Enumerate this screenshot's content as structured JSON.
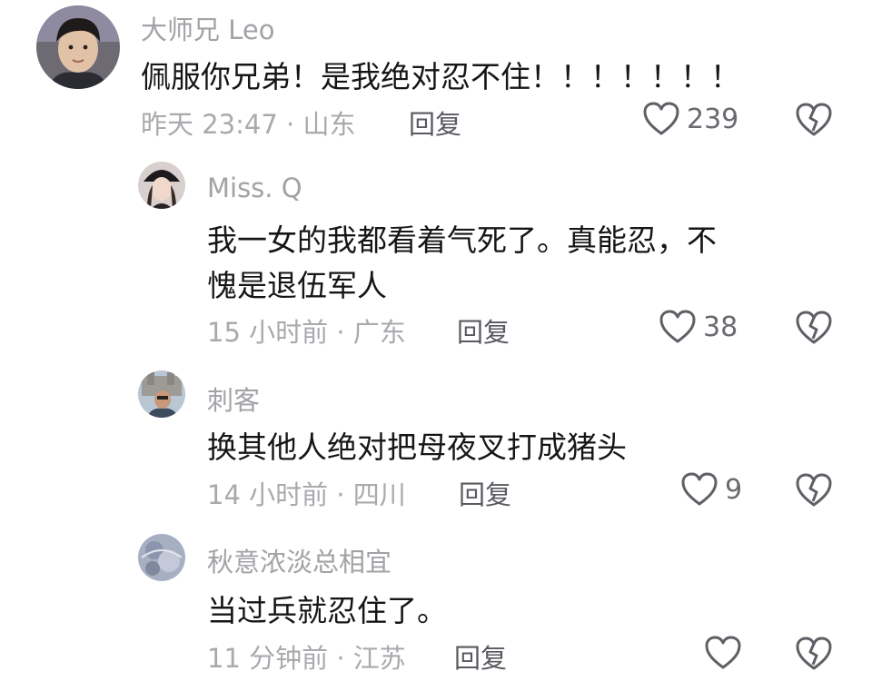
{
  "comments": [
    {
      "username": "大师兄 Leo",
      "text": "佩服你兄弟！是我绝对忍不住！！！！！！！",
      "meta": "昨天 23:47 · 山东",
      "reply": "回复",
      "likes": "239"
    },
    {
      "username": "Miss. Q",
      "text_line1": "我一女的我都看着气死了。真能忍，不",
      "text_line2": "愧是退伍军人",
      "meta": "15 小时前 · 广东",
      "reply": "回复",
      "likes": "38"
    },
    {
      "username": "刺客",
      "text": "换其他人绝对把母夜叉打成猪头",
      "meta": "14 小时前 · 四川",
      "reply": "回复",
      "likes": "9"
    },
    {
      "username": "秋意浓淡总相宜",
      "text": "当过兵就忍住了。",
      "meta": "11 分钟前 · 江苏",
      "reply": "回复",
      "likes": ""
    }
  ],
  "icons": {
    "like": "heart-outline-icon",
    "dislike": "broken-heart-icon"
  },
  "colors": {
    "username": "#a2a2a7",
    "meta": "#a9a9ae",
    "text": "#161616",
    "reply": "#595960",
    "icon": "#5f5f66"
  }
}
